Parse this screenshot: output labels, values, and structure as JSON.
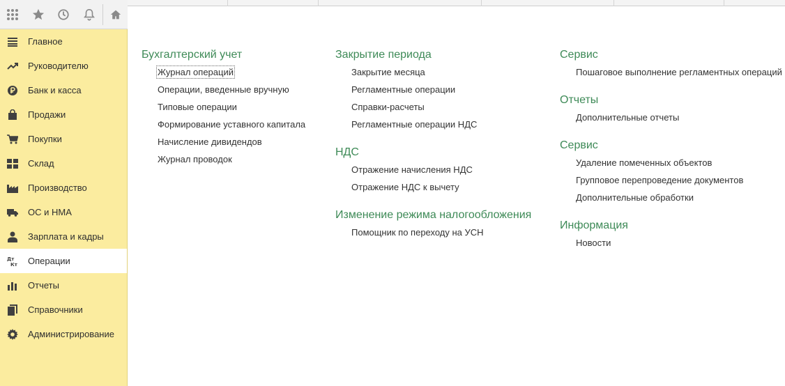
{
  "toolbar": {
    "icons": [
      "apps-grid-icon",
      "star-icon",
      "history-icon",
      "bell-icon",
      "home-icon"
    ]
  },
  "sidebar": {
    "items": [
      {
        "label": "Главное",
        "icon": "menu-lines-icon"
      },
      {
        "label": "Руководителю",
        "icon": "trend-icon"
      },
      {
        "label": "Банк и касса",
        "icon": "ruble-coin-icon"
      },
      {
        "label": "Продажи",
        "icon": "shopping-bag-icon"
      },
      {
        "label": "Покупки",
        "icon": "cart-icon"
      },
      {
        "label": "Склад",
        "icon": "warehouse-grid-icon"
      },
      {
        "label": "Производство",
        "icon": "factory-icon"
      },
      {
        "label": "ОС и НМА",
        "icon": "truck-icon"
      },
      {
        "label": "Зарплата и кадры",
        "icon": "person-icon"
      },
      {
        "label": "Операции",
        "icon": "dt-kt-icon",
        "active": true
      },
      {
        "label": "Отчеты",
        "icon": "bar-chart-icon"
      },
      {
        "label": "Справочники",
        "icon": "books-icon"
      },
      {
        "label": "Администрирование",
        "icon": "gear-icon"
      }
    ]
  },
  "columns": [
    {
      "groups": [
        {
          "title": "Бухгалтерский учет",
          "links": [
            "Журнал операций",
            "Операции, введенные вручную",
            "Типовые операции",
            "Формирование уставного капитала",
            "Начисление дивидендов",
            "Журнал проводок"
          ]
        }
      ]
    },
    {
      "groups": [
        {
          "title": "Закрытие периода",
          "links": [
            "Закрытие месяца",
            "Регламентные операции",
            "Справки-расчеты",
            "Регламентные операции НДС"
          ]
        },
        {
          "title": "НДС",
          "links": [
            "Отражение начисления НДС",
            "Отражение НДС к вычету"
          ]
        },
        {
          "title": "Изменение режима налогообложения",
          "links": [
            "Помощник по переходу на УСН"
          ]
        }
      ]
    },
    {
      "groups": [
        {
          "title": "Сервис",
          "links": [
            "Пошаговое выполнение регламентных операций"
          ]
        },
        {
          "title": "Отчеты",
          "links": [
            "Дополнительные отчеты"
          ]
        },
        {
          "title": "Сервис",
          "links": [
            "Удаление помеченных объектов",
            "Групповое перепроведение документов",
            "Дополнительные обработки"
          ]
        },
        {
          "title": "Информация",
          "links": [
            "Новости"
          ]
        }
      ]
    }
  ]
}
